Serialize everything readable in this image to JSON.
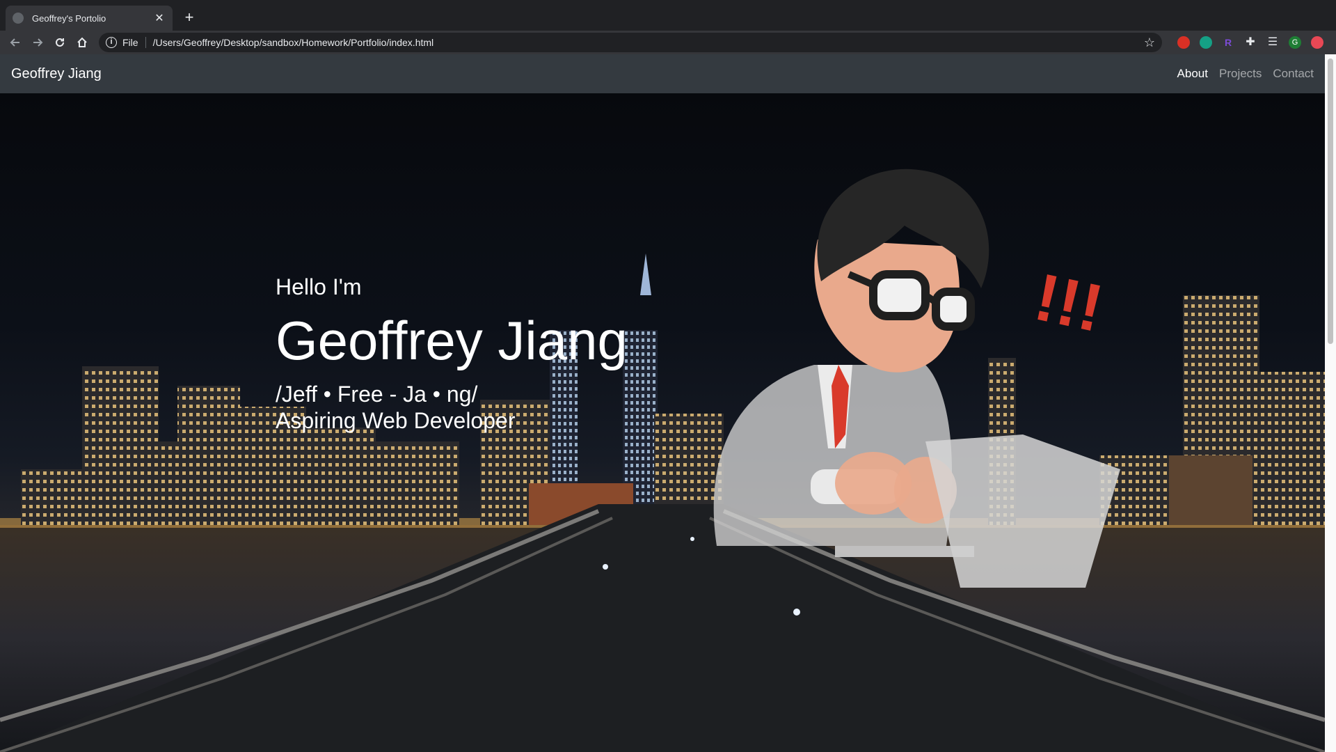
{
  "browser": {
    "tab_title": "Geoffrey's Portolio",
    "scheme_label": "File",
    "url": "/Users/Geoffrey/Desktop/sandbox/Homework/Portfolio/index.html"
  },
  "navbar": {
    "brand": "Geoffrey Jiang",
    "links": [
      {
        "label": "About",
        "active": true
      },
      {
        "label": "Projects",
        "active": false
      },
      {
        "label": "Contact",
        "active": false
      }
    ]
  },
  "hero": {
    "greeting": "Hello I'm",
    "name": "Geoffrey Jiang",
    "pronunciation": "/Jeff • Free - Ja • ng/",
    "tagline": "Aspiring Web Developer",
    "exclamation": "!!!"
  },
  "colors": {
    "navbar_bg": "#343a40",
    "accent_red": "#d93a2b"
  }
}
